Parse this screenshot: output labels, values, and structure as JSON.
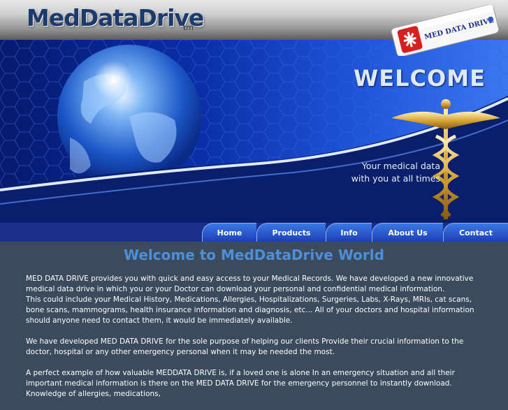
{
  "header": {
    "logo_text": "MedDataDrive",
    "trademark": "tm"
  },
  "usb": {
    "label": "MED DATA DRIVE"
  },
  "hero": {
    "welcome": "WELCOME",
    "tagline_line1": "Your medical data",
    "tagline_line2": "with you at all times"
  },
  "nav": {
    "home": "Home",
    "products": "Products",
    "info": "Info",
    "about": "About Us",
    "contact": "Contact"
  },
  "main": {
    "heading": "Welcome to MedDataDrive World",
    "p1": "MED DATA DRIVE provides you with quick and easy access to your Medical Records. We have developed a new innovative medical data drive in which you or your Doctor can download your personal and confidential medical information.",
    "p1b": "This could include your Medical History, Medications, Allergies, Hospitalizations, Surgeries, Labs, X-Rays, MRIs, cat scans, bone scans, mammograms, health insurance information and diagnosis, etc... All of your doctors and hospital information should anyone need to contact them, it would be immediately available.",
    "p2": "We have developed MED DATA DRIVE for the sole purpose of helping our clients Provide their crucial information to the doctor, hospital or any other emergency personal when it may be needed the most.",
    "p3": "A perfect example of how valuable MEDDATA DRIVE is, if a loved one is alone In an emergency situation and all their important medical information is there on the MED DATA DRIVE for the emergency personnel to instantly download. Knowledge of allergies, medications,"
  },
  "colors": {
    "nav_bg": "#1a2f8a",
    "heading": "#4d8fd8",
    "content_bg": "#3b4a5c"
  }
}
